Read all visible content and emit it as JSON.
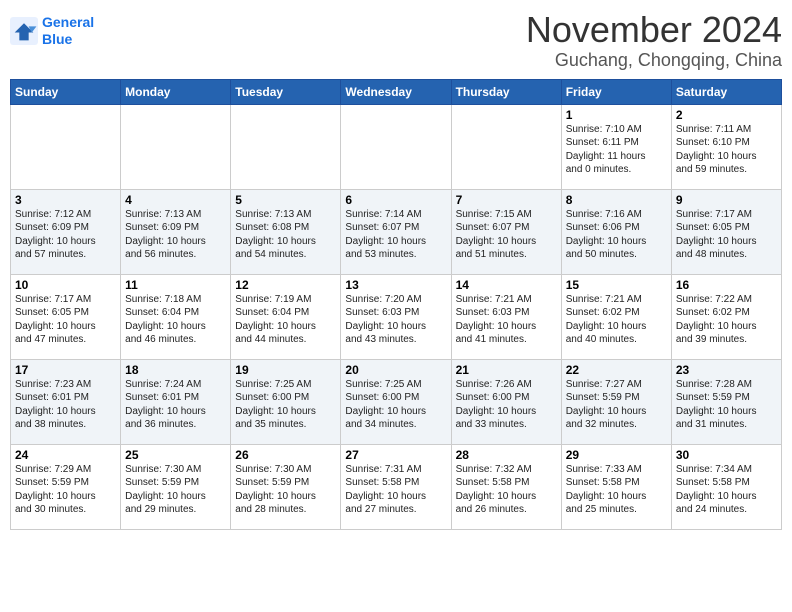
{
  "header": {
    "logo_line1": "General",
    "logo_line2": "Blue",
    "month": "November 2024",
    "location": "Guchang, Chongqing, China"
  },
  "weekdays": [
    "Sunday",
    "Monday",
    "Tuesday",
    "Wednesday",
    "Thursday",
    "Friday",
    "Saturday"
  ],
  "weeks": [
    [
      {
        "day": "",
        "info": ""
      },
      {
        "day": "",
        "info": ""
      },
      {
        "day": "",
        "info": ""
      },
      {
        "day": "",
        "info": ""
      },
      {
        "day": "",
        "info": ""
      },
      {
        "day": "1",
        "info": "Sunrise: 7:10 AM\nSunset: 6:11 PM\nDaylight: 11 hours\nand 0 minutes."
      },
      {
        "day": "2",
        "info": "Sunrise: 7:11 AM\nSunset: 6:10 PM\nDaylight: 10 hours\nand 59 minutes."
      }
    ],
    [
      {
        "day": "3",
        "info": "Sunrise: 7:12 AM\nSunset: 6:09 PM\nDaylight: 10 hours\nand 57 minutes."
      },
      {
        "day": "4",
        "info": "Sunrise: 7:13 AM\nSunset: 6:09 PM\nDaylight: 10 hours\nand 56 minutes."
      },
      {
        "day": "5",
        "info": "Sunrise: 7:13 AM\nSunset: 6:08 PM\nDaylight: 10 hours\nand 54 minutes."
      },
      {
        "day": "6",
        "info": "Sunrise: 7:14 AM\nSunset: 6:07 PM\nDaylight: 10 hours\nand 53 minutes."
      },
      {
        "day": "7",
        "info": "Sunrise: 7:15 AM\nSunset: 6:07 PM\nDaylight: 10 hours\nand 51 minutes."
      },
      {
        "day": "8",
        "info": "Sunrise: 7:16 AM\nSunset: 6:06 PM\nDaylight: 10 hours\nand 50 minutes."
      },
      {
        "day": "9",
        "info": "Sunrise: 7:17 AM\nSunset: 6:05 PM\nDaylight: 10 hours\nand 48 minutes."
      }
    ],
    [
      {
        "day": "10",
        "info": "Sunrise: 7:17 AM\nSunset: 6:05 PM\nDaylight: 10 hours\nand 47 minutes."
      },
      {
        "day": "11",
        "info": "Sunrise: 7:18 AM\nSunset: 6:04 PM\nDaylight: 10 hours\nand 46 minutes."
      },
      {
        "day": "12",
        "info": "Sunrise: 7:19 AM\nSunset: 6:04 PM\nDaylight: 10 hours\nand 44 minutes."
      },
      {
        "day": "13",
        "info": "Sunrise: 7:20 AM\nSunset: 6:03 PM\nDaylight: 10 hours\nand 43 minutes."
      },
      {
        "day": "14",
        "info": "Sunrise: 7:21 AM\nSunset: 6:03 PM\nDaylight: 10 hours\nand 41 minutes."
      },
      {
        "day": "15",
        "info": "Sunrise: 7:21 AM\nSunset: 6:02 PM\nDaylight: 10 hours\nand 40 minutes."
      },
      {
        "day": "16",
        "info": "Sunrise: 7:22 AM\nSunset: 6:02 PM\nDaylight: 10 hours\nand 39 minutes."
      }
    ],
    [
      {
        "day": "17",
        "info": "Sunrise: 7:23 AM\nSunset: 6:01 PM\nDaylight: 10 hours\nand 38 minutes."
      },
      {
        "day": "18",
        "info": "Sunrise: 7:24 AM\nSunset: 6:01 PM\nDaylight: 10 hours\nand 36 minutes."
      },
      {
        "day": "19",
        "info": "Sunrise: 7:25 AM\nSunset: 6:00 PM\nDaylight: 10 hours\nand 35 minutes."
      },
      {
        "day": "20",
        "info": "Sunrise: 7:25 AM\nSunset: 6:00 PM\nDaylight: 10 hours\nand 34 minutes."
      },
      {
        "day": "21",
        "info": "Sunrise: 7:26 AM\nSunset: 6:00 PM\nDaylight: 10 hours\nand 33 minutes."
      },
      {
        "day": "22",
        "info": "Sunrise: 7:27 AM\nSunset: 5:59 PM\nDaylight: 10 hours\nand 32 minutes."
      },
      {
        "day": "23",
        "info": "Sunrise: 7:28 AM\nSunset: 5:59 PM\nDaylight: 10 hours\nand 31 minutes."
      }
    ],
    [
      {
        "day": "24",
        "info": "Sunrise: 7:29 AM\nSunset: 5:59 PM\nDaylight: 10 hours\nand 30 minutes."
      },
      {
        "day": "25",
        "info": "Sunrise: 7:30 AM\nSunset: 5:59 PM\nDaylight: 10 hours\nand 29 minutes."
      },
      {
        "day": "26",
        "info": "Sunrise: 7:30 AM\nSunset: 5:59 PM\nDaylight: 10 hours\nand 28 minutes."
      },
      {
        "day": "27",
        "info": "Sunrise: 7:31 AM\nSunset: 5:58 PM\nDaylight: 10 hours\nand 27 minutes."
      },
      {
        "day": "28",
        "info": "Sunrise: 7:32 AM\nSunset: 5:58 PM\nDaylight: 10 hours\nand 26 minutes."
      },
      {
        "day": "29",
        "info": "Sunrise: 7:33 AM\nSunset: 5:58 PM\nDaylight: 10 hours\nand 25 minutes."
      },
      {
        "day": "30",
        "info": "Sunrise: 7:34 AM\nSunset: 5:58 PM\nDaylight: 10 hours\nand 24 minutes."
      }
    ]
  ]
}
